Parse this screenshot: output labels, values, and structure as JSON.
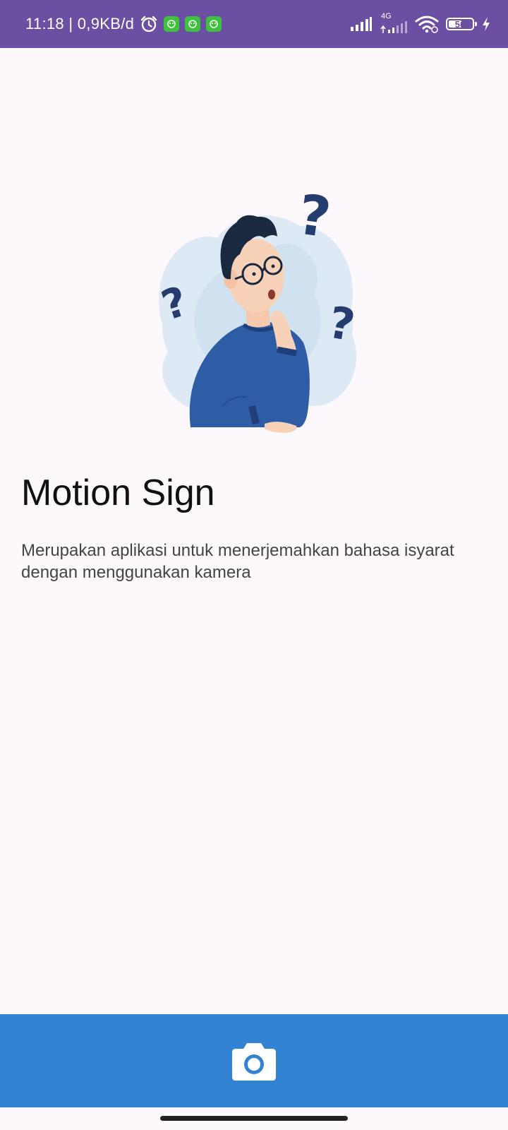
{
  "status_bar": {
    "time_and_speed": "11:18 | 0,9KB/d",
    "network_type": "4G",
    "battery_level": "56",
    "battery_fraction": 0.56,
    "icons": [
      "alarm-icon",
      "app-notification-icon",
      "app-notification-icon",
      "app-notification-icon",
      "signal-icon",
      "signal-4g-icon",
      "wifi-icon",
      "battery-icon",
      "charging-icon"
    ],
    "color": "#6a4fa3"
  },
  "main": {
    "illustration": "confused-person-illustration",
    "title": "Motion Sign",
    "description": "Merupakan aplikasi untuk menerjemahkan bahasa isyarat dengan menggunakan kamera"
  },
  "bottom_button": {
    "icon": "camera-icon",
    "color": "#3383d3"
  }
}
